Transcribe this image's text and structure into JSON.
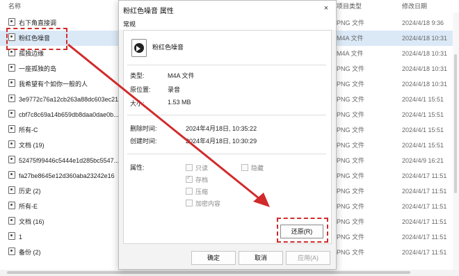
{
  "explorer": {
    "columns": {
      "name": "名称",
      "type": "项目类型",
      "date": "修改日期"
    },
    "rows": [
      {
        "name": "右下角直接调",
        "type": "PNG 文件",
        "date": "2024/4/18 9:36"
      },
      {
        "name": "粉红色噪音",
        "type": "M4A 文件",
        "date": "2024/4/18 10:31"
      },
      {
        "name": "孤独边缘",
        "type": "M4A 文件",
        "date": "2024/4/18 10:31"
      },
      {
        "name": "一座孤独的岛",
        "type": "PNG 文件",
        "date": "2024/4/18 10:31"
      },
      {
        "name": "我希望有个如你一般的人",
        "type": "PNG 文件",
        "date": "2024/4/18 10:31"
      },
      {
        "name": "3e9772c76a12cb263a88dc603ec21",
        "type": "PNG 文件",
        "date": "2024/4/1 15:51"
      },
      {
        "name": "cbf7c8c69a14b659db8daa0dae0b...",
        "type": "PNG 文件",
        "date": "2024/4/1 15:51"
      },
      {
        "name": "所有-C",
        "type": "PNG 文件",
        "date": "2024/4/1 15:51"
      },
      {
        "name": "文档 (19)",
        "type": "PNG 文件",
        "date": "2024/4/1 15:51"
      },
      {
        "name": "52475f99446c5444e1d285bc5547...",
        "type": "PNG 文件",
        "date": "2024/4/9 16:21"
      },
      {
        "name": "fa27be8645e12d360aba23242e16",
        "type": "PNG 文件",
        "date": "2024/4/17 11:51"
      },
      {
        "name": "历史 (2)",
        "type": "PNG 文件",
        "date": "2024/4/17 11:51"
      },
      {
        "name": "所有-E",
        "type": "PNG 文件",
        "date": "2024/4/17 11:51"
      },
      {
        "name": "文档 (16)",
        "type": "PNG 文件",
        "date": "2024/4/17 11:51"
      },
      {
        "name": "1",
        "type": "PNG 文件",
        "date": "2024/4/17 11:51"
      },
      {
        "name": "备份 (2)",
        "type": "PNG 文件",
        "date": "2024/4/17 11:51"
      }
    ]
  },
  "dialog": {
    "title": "粉红色噪音 属性",
    "close": "×",
    "tab": "常规",
    "filename": "粉红色噪音",
    "type_label": "类型:",
    "type_value": "M4A 文件",
    "location_label": "原位置:",
    "location_value": "录音",
    "size_label": "大小:",
    "size_value": "1.53 MB",
    "deleted_label": "删除时间:",
    "deleted_value": "2024年4月18日, 10:35:22",
    "created_label": "创建时间:",
    "created_value": "2024年4月18日, 10:30:29",
    "attributes_label": "属性:",
    "attributes": {
      "readonly": "只读",
      "hidden": "隐藏",
      "archive": "存档",
      "compressed": "压缩",
      "encrypted": "加密内容"
    },
    "restore": "还原(R)",
    "ok": "确定",
    "cancel": "取消",
    "apply": "应用(A)"
  },
  "annotation": {
    "color": "#d12a2a"
  }
}
